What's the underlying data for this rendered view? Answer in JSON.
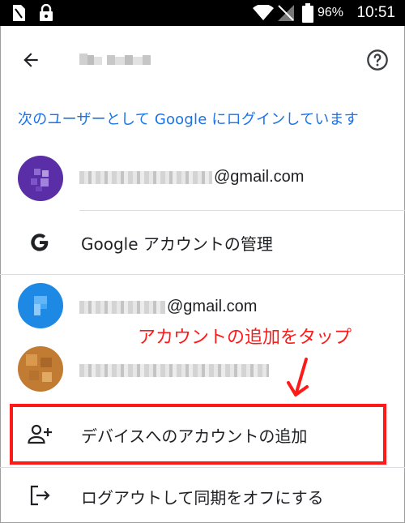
{
  "status_bar": {
    "battery_percent": "96%",
    "time": "10:51"
  },
  "app_bar": {
    "back_icon": "arrow-back-icon",
    "help_icon": "help-circle-icon"
  },
  "signin_note": "次のユーザーとして Google にログインしています",
  "accounts": [
    {
      "email_suffix": "@gmail.com",
      "avatar_color": "#5a2ea6"
    },
    {
      "email_suffix": "@gmail.com",
      "avatar_color": "#1e88e5"
    },
    {
      "avatar_color": "#c27b33"
    }
  ],
  "menu": {
    "manage_account": "Google アカウントの管理",
    "add_account": "デバイスへのアカウントの追加",
    "sign_out": "ログアウトして同期をオフにする"
  },
  "annotation": {
    "text": "アカウントの追加をタップ",
    "color": "#ff1a1a"
  },
  "colors": {
    "accent": "#1a73e8",
    "divider": "#dadce0"
  }
}
